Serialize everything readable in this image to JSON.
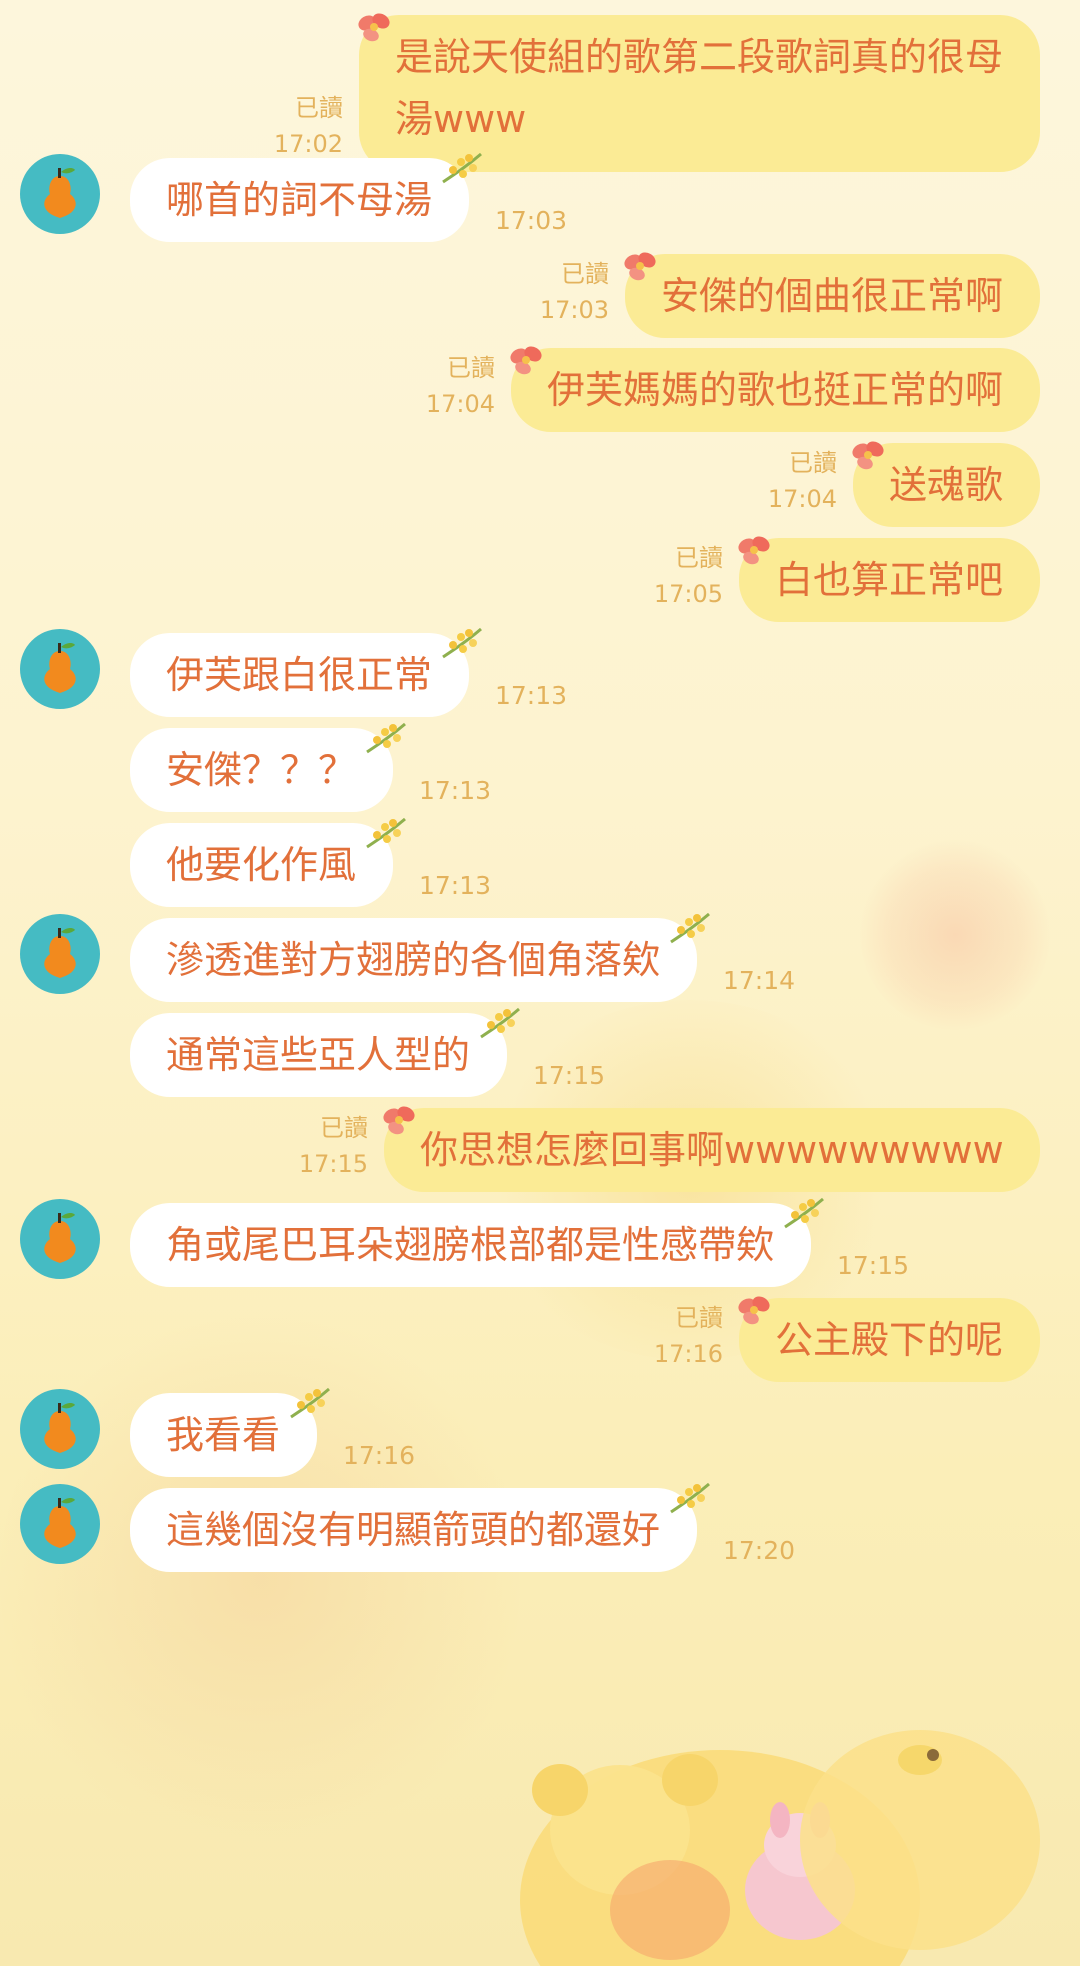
{
  "chat": {
    "read_label": "已讀",
    "messages": [
      {
        "side": "sent",
        "lines": [
          "是說天使組的歌第二段歌詞真的很母",
          "湯www"
        ],
        "time": "17:02",
        "read": true
      },
      {
        "side": "recv",
        "text": "哪首的詞不母湯",
        "time": "17:03",
        "avatar": true
      },
      {
        "side": "sent",
        "text": "安傑的個曲很正常啊",
        "time": "17:03",
        "read": true
      },
      {
        "side": "sent",
        "text": "伊芙媽媽的歌也挺正常的啊",
        "time": "17:04",
        "read": true
      },
      {
        "side": "sent",
        "text": "送魂歌",
        "time": "17:04",
        "read": true
      },
      {
        "side": "sent",
        "text": "白也算正常吧",
        "time": "17:05",
        "read": true
      },
      {
        "side": "recv",
        "text": "伊芙跟白很正常",
        "time": "17:13",
        "avatar": true
      },
      {
        "side": "recv",
        "text": "安傑？？？",
        "time": "17:13",
        "avatar": false
      },
      {
        "side": "recv",
        "text": "他要化作風",
        "time": "17:13",
        "avatar": false
      },
      {
        "side": "recv",
        "text": "滲透進對方翅膀的各個角落欸",
        "time": "17:14",
        "avatar": true
      },
      {
        "side": "recv",
        "text": "通常這些亞人型的",
        "time": "17:15",
        "avatar": false
      },
      {
        "side": "sent",
        "text": "你思想怎麼回事啊wwwwwwwww",
        "time": "17:15",
        "read": true
      },
      {
        "side": "recv",
        "text": "角或尾巴耳朵翅膀根部都是性感帶欸",
        "time": "17:15",
        "avatar": true
      },
      {
        "side": "sent",
        "text": "公主殿下的呢",
        "time": "17:16",
        "read": true
      },
      {
        "side": "recv",
        "text": "我看看",
        "time": "17:16",
        "avatar": true
      },
      {
        "side": "recv",
        "text": "這幾個沒有明顯箭頭的都還好",
        "time": "17:20",
        "avatar": true
      }
    ]
  },
  "colors": {
    "text": "#e2703a",
    "meta": "#e3b25c",
    "sent_bubble": "#fbeb95",
    "recv_bubble": "#ffffff",
    "avatar_bg": "#45bbc3",
    "avatar_fruit": "#f28a1e"
  },
  "icons": {
    "avatar": "orange-fruit-icon",
    "sent_decoration": "flower-bow-icon",
    "recv_decoration": "flower-sprig-icon"
  }
}
